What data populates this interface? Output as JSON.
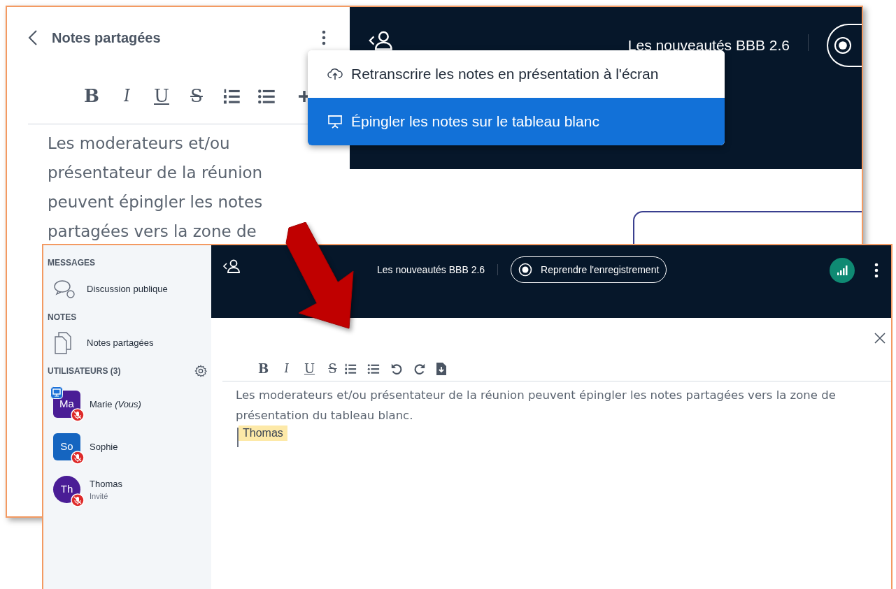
{
  "top_window": {
    "panel_title": "Notes partagées",
    "toolbar": [
      "B",
      "I",
      "U",
      "S"
    ],
    "note_text": "Les moderateurs et/ou présentateur de la réunion peuvent épingler les notes partagées vers la zone de",
    "meeting_title": "Les nouveautés BBB 2.6",
    "menu": [
      {
        "label": "Retranscrire les notes en présentation à l'écran",
        "selected": false
      },
      {
        "label": "Épingler les notes sur le tableau blanc",
        "selected": true
      }
    ]
  },
  "bottom_window": {
    "sidebar": {
      "messages_heading": "MESSAGES",
      "messages_item": "Discussion publique",
      "notes_heading": "NOTES",
      "notes_item": "Notes partagées",
      "users_heading": "UTILISATEURS (3)",
      "users": [
        {
          "initials": "Ma",
          "name": "Marie *(Vous)*",
          "kind": "moderator",
          "presenter": true,
          "color": "#4a1d96"
        },
        {
          "initials": "So",
          "name": "Sophie",
          "kind": "moderator",
          "presenter": false,
          "color": "#1565c0"
        },
        {
          "initials": "Th",
          "name": "Thomas",
          "role": "Invité",
          "kind": "viewer",
          "presenter": false,
          "color": "#4a1d96"
        }
      ]
    },
    "meeting_title": "Les nouveautés BBB 2.6",
    "record_button": "Reprendre l'enregistrement",
    "toolbar": [
      "B",
      "I",
      "U",
      "S"
    ],
    "note_text": "Les moderateurs et/ou présentateur de la réunion peuvent épingler les notes partagées vers la zone de présentation du tableau blanc.",
    "cursor_label": "Thomas"
  }
}
